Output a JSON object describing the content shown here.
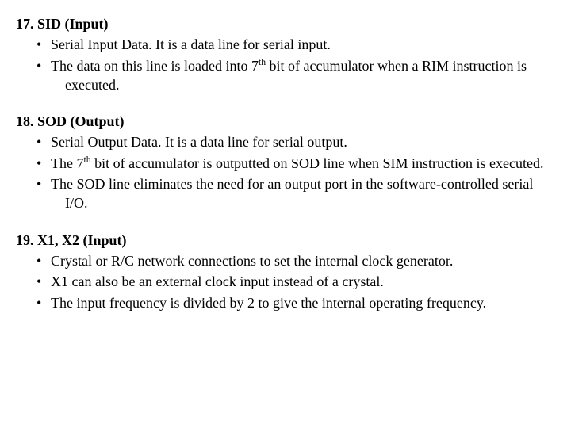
{
  "sections": [
    {
      "heading": "17.  SID (Input)",
      "bullets": [
        {
          "pre": "Serial Input Data. It is a data line for serial input."
        },
        {
          "pre": "The data on this line is loaded into 7",
          "sup": "th",
          "post": " bit of accumulator when a RIM instruction is executed."
        }
      ]
    },
    {
      "heading": "18.  SOD (Output)",
      "bullets": [
        {
          "pre": "Serial Output Data. It is a data line for serial output."
        },
        {
          "pre": "The 7",
          "sup": "th",
          "post": " bit of accumulator is outputted on SOD line when SIM instruction is executed."
        },
        {
          "pre": "The SOD line eliminates the need for an output port in the software-controlled serial I/O."
        }
      ]
    },
    {
      "heading": "19.  X1, X2 (Input)",
      "bullets": [
        {
          "pre": "Crystal or R/C network connections to set the internal clock generator."
        },
        {
          "pre": "X1 can also be an external clock input instead of a crystal."
        },
        {
          "pre": "The input frequency is divided by 2 to give the internal operating frequency."
        }
      ]
    }
  ]
}
